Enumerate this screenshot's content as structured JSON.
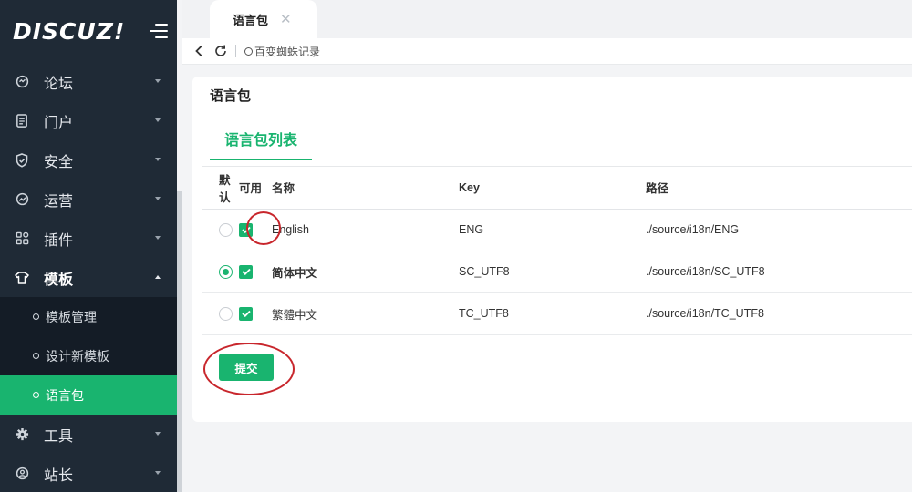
{
  "app": {
    "logo": "DISCUZ!"
  },
  "sidebar": {
    "items": [
      {
        "label": "论坛",
        "icon": "forum-icon"
      },
      {
        "label": "门户",
        "icon": "portal-icon"
      },
      {
        "label": "安全",
        "icon": "shield-icon"
      },
      {
        "label": "运营",
        "icon": "operations-icon"
      },
      {
        "label": "插件",
        "icon": "plugins-icon"
      },
      {
        "label": "模板",
        "icon": "template-icon",
        "open": true
      },
      {
        "label": "工具",
        "icon": "gear-icon"
      },
      {
        "label": "站长",
        "icon": "webmaster-icon"
      }
    ],
    "submenu": [
      {
        "label": "模板管理"
      },
      {
        "label": "设计新模板"
      },
      {
        "label": "语言包",
        "active": true
      }
    ]
  },
  "tabs": [
    {
      "label": "语言包",
      "active": true
    }
  ],
  "address": {
    "text": "百变蜘蛛记录"
  },
  "page": {
    "title": "语言包",
    "active_tab": "语言包列表",
    "columns": {
      "default": "默认",
      "enabled": "可用",
      "name": "名称",
      "key": "Key",
      "path": "路径"
    },
    "rows": [
      {
        "default": false,
        "enabled": true,
        "name": "English",
        "key": "ENG",
        "path": "./source/i18n/ENG",
        "bold": false
      },
      {
        "default": true,
        "enabled": true,
        "name": "简体中文",
        "key": "SC_UTF8",
        "path": "./source/i18n/SC_UTF8",
        "bold": true
      },
      {
        "default": false,
        "enabled": true,
        "name": "繁體中文",
        "key": "TC_UTF8",
        "path": "./source/i18n/TC_UTF8",
        "bold": false
      }
    ],
    "submit_label": "提交"
  },
  "colors": {
    "accent": "#19b46f",
    "sidebar_bg": "#1f2a36",
    "submenu_bg": "#141c26",
    "annotation": "#c8262c"
  }
}
